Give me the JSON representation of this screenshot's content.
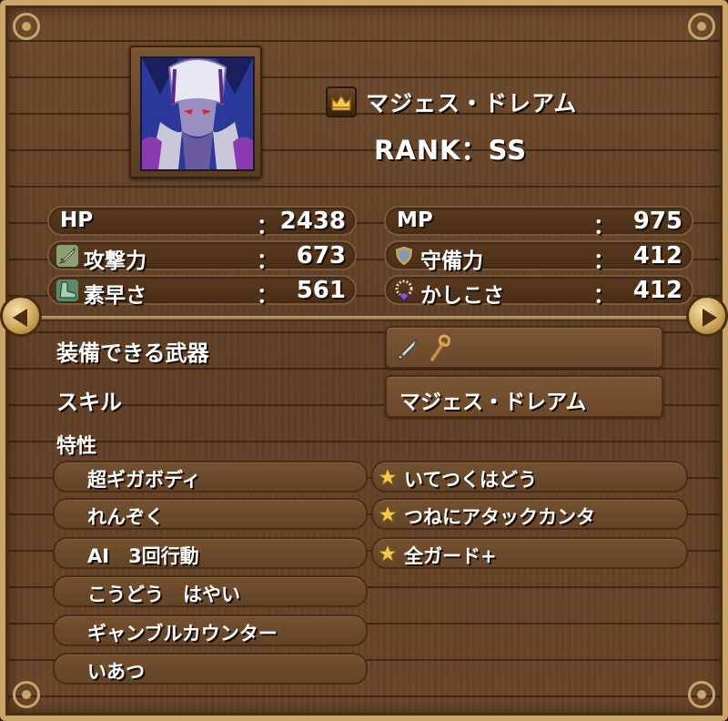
{
  "monster": {
    "name": "マジェス・ドレアム",
    "rank": "RANK：SS"
  },
  "stats": [
    {
      "label": "HP",
      "colon": "：",
      "value": "2438",
      "icon": ""
    },
    {
      "label": "MP",
      "colon": "：",
      "value": "975",
      "icon": ""
    },
    {
      "label": "攻撃力",
      "colon": "：",
      "value": "673",
      "icon": "sword-icon"
    },
    {
      "label": "守備力",
      "colon": "：",
      "value": "412",
      "icon": "shield-icon"
    },
    {
      "label": "素早さ",
      "colon": "：",
      "value": "561",
      "icon": "boot-icon"
    },
    {
      "label": "かしこさ",
      "colon": "：",
      "value": "412",
      "icon": "rosary-icon"
    }
  ],
  "equipment": {
    "label": "装備できる武器",
    "weapons": [
      "sword-icon",
      "staff-icon"
    ]
  },
  "skill": {
    "label": "スキル",
    "value": "マジェス・ドレアム"
  },
  "traits": {
    "label": "特性",
    "innate": [
      "超ギガボディ",
      "れんぞく",
      "AI　3回行動",
      "こうどう　はやい",
      "ギャンブルカウンター",
      "いあつ"
    ],
    "extra": [
      {
        "name": "いてつくはどう",
        "icon": "star-icon"
      },
      {
        "name": "つねにアタックカンタ",
        "icon": "star-icon"
      },
      {
        "name": "全ガード+",
        "icon": "star-icon"
      }
    ]
  },
  "nav": {
    "prev": "prev-arrow",
    "next": "next-arrow"
  },
  "colors": {
    "frame": "#c9a56a",
    "wood": "#6a4629",
    "text": "#ffffff",
    "star": "#f2c94c"
  }
}
